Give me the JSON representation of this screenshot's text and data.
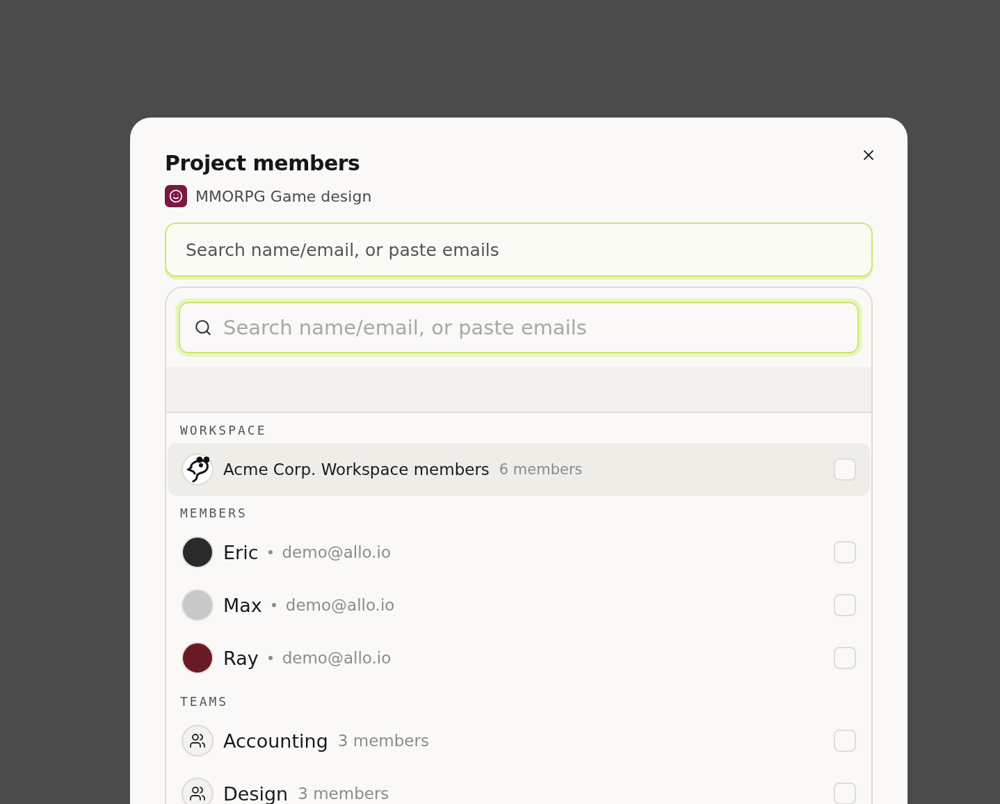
{
  "dialog": {
    "title": "Project members",
    "project": {
      "name": "MMORPG Game design"
    },
    "search": {
      "placeholder": "Search name/email, or paste emails"
    },
    "dropdown": {
      "search": {
        "placeholder": "Search name/email, or paste emails"
      },
      "sections": [
        {
          "heading": "WORKSPACE",
          "items": [
            {
              "kind": "workspace",
              "name": "Acme Corp. Workspace members",
              "detail": "6 members",
              "checked": false,
              "selected": true
            }
          ]
        },
        {
          "heading": "MEMBERS",
          "items": [
            {
              "kind": "person",
              "name": "Eric",
              "detail": "demo@allo.io",
              "checked": false,
              "selected": false
            },
            {
              "kind": "person",
              "name": "Max",
              "detail": "demo@allo.io",
              "checked": false,
              "selected": false
            },
            {
              "kind": "person",
              "name": "Ray",
              "detail": "demo@allo.io",
              "checked": false,
              "selected": false
            }
          ]
        },
        {
          "heading": "TEAMS",
          "items": [
            {
              "kind": "team",
              "name": "Accounting",
              "detail": "3 members",
              "checked": false,
              "selected": false
            },
            {
              "kind": "team",
              "name": "Design",
              "detail": "3 members",
              "checked": false,
              "selected": false
            }
          ]
        }
      ]
    }
  }
}
